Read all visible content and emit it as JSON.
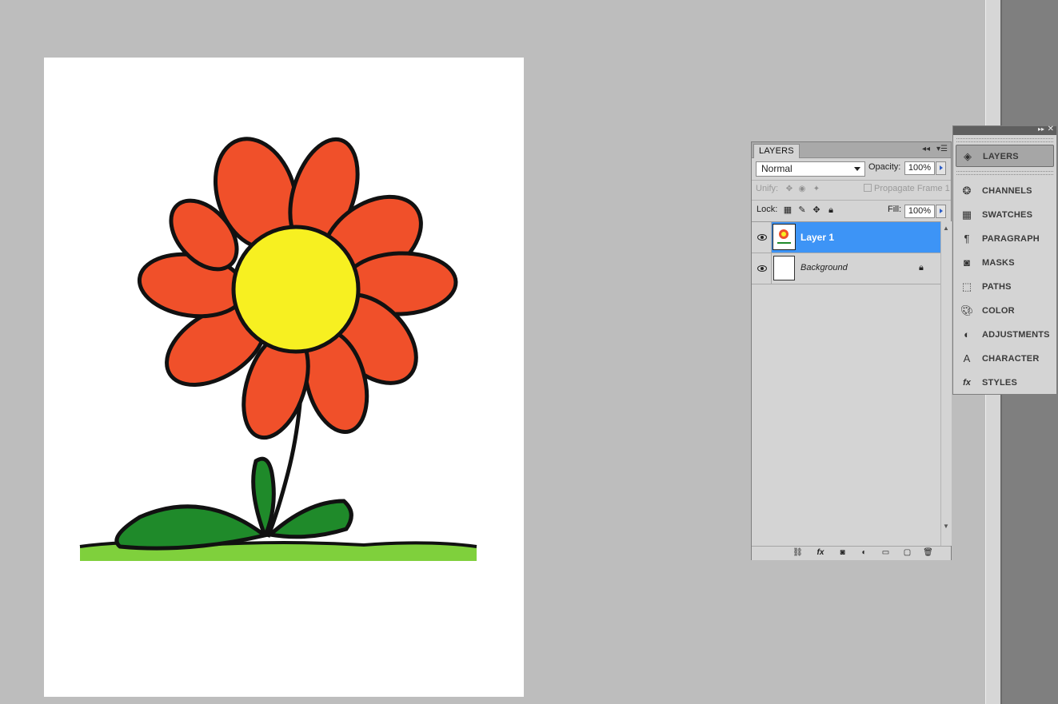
{
  "layers_panel": {
    "tab_label": "LAYERS",
    "blend_mode": "Normal",
    "opacity_label": "Opacity:",
    "opacity_value": "100%",
    "unify_label": "Unify:",
    "propagate_label": "Propagate Frame 1",
    "lock_label": "Lock:",
    "fill_label": "Fill:",
    "fill_value": "100%",
    "layers": [
      {
        "name": "Layer 1",
        "selected": true,
        "visible": true
      },
      {
        "name": "Background",
        "selected": false,
        "visible": true,
        "locked": true
      }
    ],
    "footer_icons": [
      "link-layers-icon",
      "fx-icon",
      "mask-icon",
      "adjustment-icon",
      "group-folder-icon",
      "new-layer-icon",
      "trash-icon"
    ]
  },
  "dock": {
    "items": [
      {
        "label": "LAYERS",
        "icon": "layers-icon",
        "active": true
      },
      {
        "label": "CHANNELS",
        "icon": "channels-icon"
      },
      {
        "label": "SWATCHES",
        "icon": "swatches-icon"
      },
      {
        "label": "PARAGRAPH",
        "icon": "paragraph-icon"
      },
      {
        "label": "MASKS",
        "icon": "masks-icon"
      },
      {
        "label": "PATHS",
        "icon": "paths-icon"
      },
      {
        "label": "COLOR",
        "icon": "color-icon"
      },
      {
        "label": "ADJUSTMENTS",
        "icon": "adjustments-icon"
      },
      {
        "label": "CHARACTER",
        "icon": "character-icon"
      },
      {
        "label": "STYLES",
        "icon": "styles-icon"
      }
    ]
  },
  "colors": {
    "workspace": "#bdbdbd",
    "selection": "#3d94f6",
    "petal": "#f0502a",
    "center": "#f7f021",
    "leaf": "#1f8a2a",
    "grass": "#7fd03c"
  }
}
